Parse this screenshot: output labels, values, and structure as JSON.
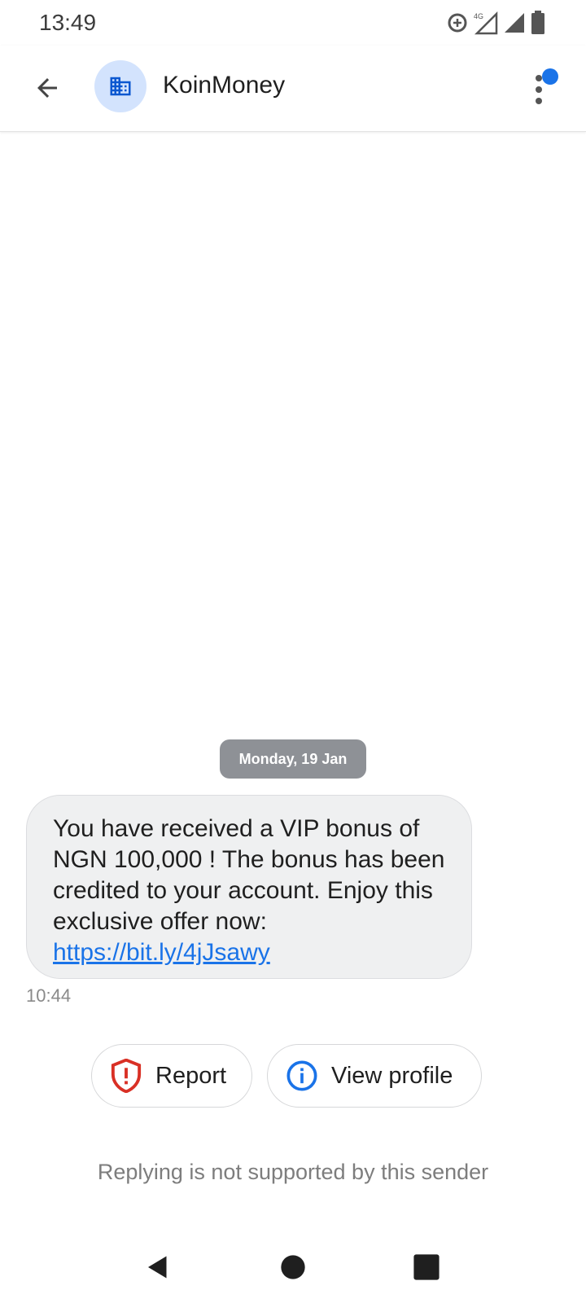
{
  "status_bar": {
    "time": "13:49",
    "network_label": "4G",
    "icons": [
      "data-saver-icon",
      "signal-4g-icon",
      "signal-icon",
      "battery-icon"
    ]
  },
  "app_bar": {
    "contact_name": "KoinMoney",
    "avatar_icon": "business-icon",
    "back_icon": "arrow-back-icon",
    "more_icon": "more-vert-icon",
    "accent_color": "#1a73e8"
  },
  "conversation": {
    "date_label": "Monday, 19 Jan",
    "message": {
      "text": "You have received a VIP bonus of NGN 100,000 ! The bonus has been credited to your account. Enjoy this exclusive offer now:",
      "link": "https://bit.ly/4jJsawy",
      "time": "10:44"
    }
  },
  "actions": {
    "report_label": "Report",
    "view_profile_label": "View profile"
  },
  "footer": {
    "reply_note": "Replying is not supported by this sender"
  },
  "nav": {
    "back_icon": "nav-back-icon",
    "home_icon": "nav-home-icon",
    "recents_icon": "nav-recents-icon"
  }
}
